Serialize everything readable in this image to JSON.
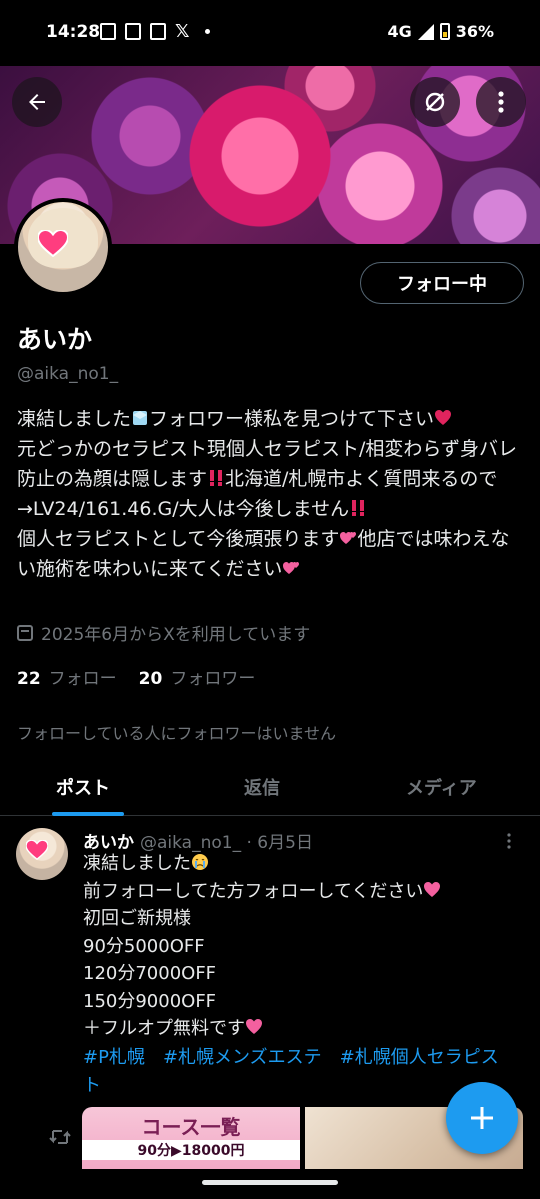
{
  "status_bar": {
    "time": "14:28",
    "network": "4G",
    "battery": "36%"
  },
  "profile": {
    "follow_button": "フォロー中",
    "name": "あいか",
    "handle": "@aika_no1_",
    "bio": {
      "p1": "凍結しました",
      "p2": "フォロワー様私を見つけて下さい",
      "p3": "\n元どっかのセラピスト現個人セラピスト/相変わらず身バレ防止の為顔は隠します",
      "p4": "北海道/札幌市よく質問来るので→LV24/161.46.G/大人は今後しません",
      "p5": "\n個人セラピストとして今後頑張ります",
      "p6": "他店では味わえない施術を味わいに来てください"
    },
    "joined": "2025年6月からXを利用しています",
    "following_count": "22",
    "following_label": "フォロー",
    "followers_count": "20",
    "followers_label": "フォロワー",
    "no_followers_note": "フォローしている人にフォロワーはいません"
  },
  "tabs": [
    {
      "label": "ポスト"
    },
    {
      "label": "返信"
    },
    {
      "label": "メディア"
    }
  ],
  "post": {
    "author": "あいか",
    "meta": "@aika_no1_ · 6月5日",
    "l1": "凍結しました",
    "l2": "\n前フォローしてた方フォローしてください",
    "l3": "\n初回ご新規様\n90分5000OFF\n120分7000OFF\n150分9000OFF\n＋フルオプ無料です",
    "hashtags": [
      "#P札幌",
      "#札幌メンズエステ",
      "#札幌個人セラピスト"
    ],
    "media_title": "コース一覧",
    "media_line": "90分▶18000円"
  },
  "colors": {
    "accent": "#1d9bf0",
    "background": "#000000",
    "secondary_text": "#71767b"
  },
  "icons": [
    "back-arrow-icon",
    "sync-off-icon",
    "more-vertical-icon",
    "calendar-icon",
    "repost-icon",
    "plus-icon",
    "heart-icon"
  ]
}
